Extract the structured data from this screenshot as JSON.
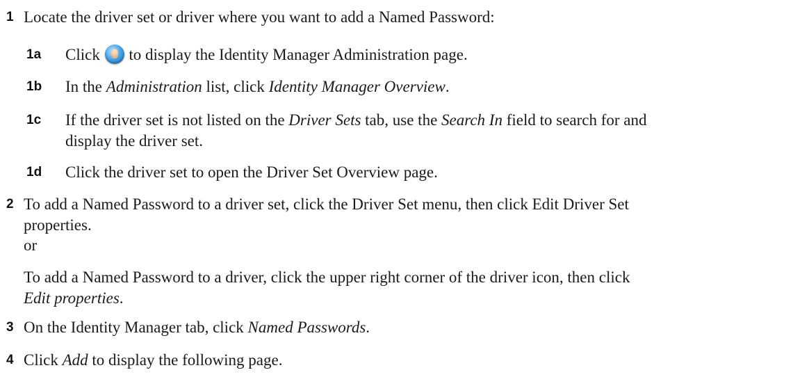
{
  "steps": {
    "s1": {
      "num": "1",
      "text": "Locate the driver set or driver where you want to add a Named Password:"
    },
    "s1a": {
      "num": "1a",
      "pre": "Click ",
      "icon": "identity-manager-administration-icon",
      "post": " to display the Identity Manager Administration page."
    },
    "s1b": {
      "num": "1b",
      "pre": "In the ",
      "em1": "Administration",
      "mid": " list, click ",
      "em2": "Identity Manager Overview",
      "post": "."
    },
    "s1c": {
      "num": "1c",
      "line1_pre": "If the driver set is not listed on the ",
      "line1_em1": "Driver Sets",
      "line1_mid": " tab, use the ",
      "line1_em2": "Search In",
      "line1_post": " field to search for and",
      "line2": "display the driver set."
    },
    "s1d": {
      "num": "1d",
      "text": "Click the driver set to open the Driver Set Overview page."
    },
    "s2": {
      "num": "2",
      "line1": "To add a Named Password to a driver set, click the Driver Set menu, then click Edit Driver Set",
      "line2": "properties.",
      "or": "or",
      "alt_line1": "To add a Named Password to a driver, click the upper right corner of the driver icon, then click",
      "alt_em": "Edit properties",
      "alt_post": "."
    },
    "s3": {
      "num": "3",
      "pre": "On the Identity Manager tab, click ",
      "em": "Named Passwords",
      "post": "."
    },
    "s4": {
      "num": "4",
      "pre": "Click ",
      "em": "Add",
      "post": " to display the following page."
    }
  }
}
